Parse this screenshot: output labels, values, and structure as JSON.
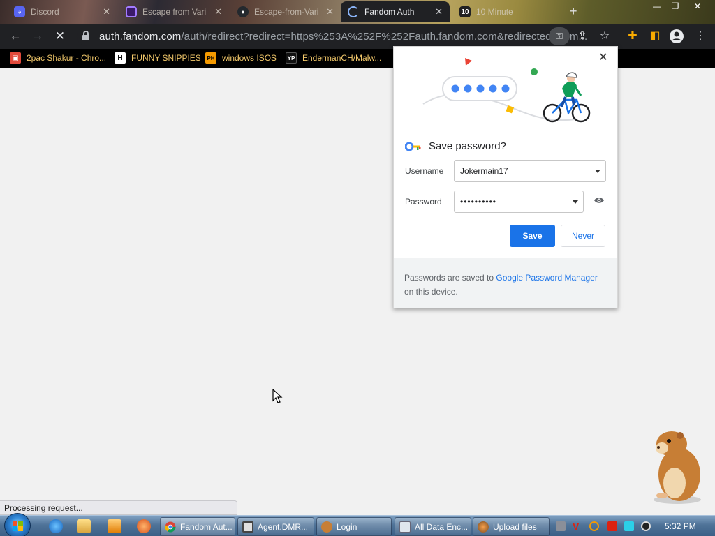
{
  "tabs": [
    {
      "title": "Discord",
      "icon": "discord-icon",
      "active": false
    },
    {
      "title": "Escape from Vari",
      "icon": "escape-icon",
      "active": false
    },
    {
      "title": "Escape-from-Vari",
      "icon": "github-icon",
      "active": false
    },
    {
      "title": "Fandom Auth",
      "icon": "loading-icon",
      "active": true
    },
    {
      "title": "10 Minute",
      "icon": "ten-minute-icon",
      "active": false
    }
  ],
  "new_tab_label": "+",
  "window_controls": {
    "minimize": "—",
    "restore": "❐",
    "close": "✕"
  },
  "address_bar": {
    "host": "auth.fandom.com",
    "path": "/auth/redirect?redirect=https%253A%252F%252Fauth.fandom.com&redirected_from..."
  },
  "bookmarks": [
    {
      "label": "2pac Shakur - Chro...",
      "icon": "bookmark-gift-icon",
      "badge": "🎁",
      "color": "#e24a3b"
    },
    {
      "label": "FUNNY SNIPPIES",
      "icon": "bookmark-h-icon",
      "badge": "H",
      "color": "#ffffff"
    },
    {
      "label": "windows ISOS",
      "icon": "bookmark-ph-icon",
      "badge": "PH",
      "color": "#f59a00"
    },
    {
      "label": "EndermanCH/Malw...",
      "icon": "bookmark-yp-icon",
      "badge": "YP",
      "color": "#111111"
    }
  ],
  "popup": {
    "title": "Save password?",
    "username_label": "Username",
    "username_value": "Jokermain17",
    "password_label": "Password",
    "password_value": "••••••••••",
    "save_label": "Save",
    "never_label": "Never",
    "footer_prefix": "Passwords are saved to ",
    "footer_link": "Google Password Manager",
    "footer_suffix": " on this device.",
    "close_label": "✕"
  },
  "status_text": "Processing request...",
  "taskbar": {
    "tasks": [
      {
        "label": "Fandom Aut...",
        "icon": "chrome-icon",
        "active": true
      },
      {
        "label": "Agent.DMR...",
        "icon": "window-icon",
        "active": false
      },
      {
        "label": "Login",
        "icon": "hamster-app-icon",
        "active": false
      },
      {
        "label": "All Data Enc...",
        "icon": "folder-window-icon",
        "active": false
      },
      {
        "label": "Upload files",
        "icon": "upload-app-icon",
        "active": false
      }
    ],
    "clock": "5:32 PM"
  },
  "colors": {
    "accent": "#1a73e8",
    "toolbar": "#202124",
    "bookmark_text": "#f3c96b"
  }
}
